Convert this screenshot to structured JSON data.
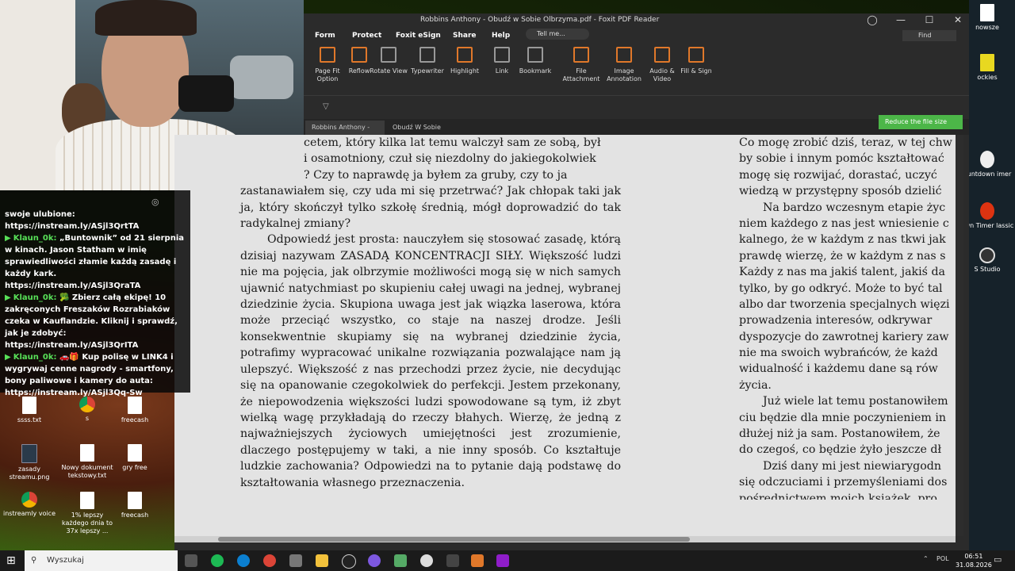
{
  "window": {
    "title": "Robbins Anthony - Obudź w Sobie Olbrzyma.pdf - Foxit PDF Reader"
  },
  "menu": [
    "Form",
    "Protect",
    "Foxit eSign",
    "Share",
    "Help"
  ],
  "tell_me": "Tell me...",
  "find": "Find",
  "ribbon": [
    "Page Fit Option",
    "Reflow",
    "Rotate View",
    "Typewriter",
    "Highlight",
    "Link",
    "Bookmark",
    "File Attachment",
    "Image Annotation",
    "Audio & Video",
    "Fill & Sign"
  ],
  "tabs": [
    "Robbins Anthony - O...",
    "Obudź W Sobie Olbrzym..."
  ],
  "reduce_button": "Reduce the file size",
  "page_left": [
    "cetem, który kilka lat temu walczył sam ze sobą, był",
    "i osamotniony, czuł się niezdolny do jakiegokolwiek",
    "? Czy to naprawdę ja byłem za gruby, czy to ja",
    "zastanawiałem się, czy uda mi się przetrwać? Jak chłopak taki jak ja, który skończył tylko szkołę średnią, mógł doprowadzić do tak radykalnej zmiany?",
    "Odpowiedź jest prosta: nauczyłem się stosować zasadę, którą dzisiaj nazywam ZASADĄ KONCENTRACJI SIŁY. Większość ludzi nie ma pojęcia, jak olbrzymie możliwości mogą się w nich samych ujawnić natychmiast po skupieniu całej uwagi na jednej, wybranej dziedzinie życia. Skupiona uwaga jest jak wiązka laserowa, która może przeciąć wszystko, co staje na naszej drodze. Jeśli konsekwentnie skupiamy się na wybranej dziedzinie życia, potrafimy wypracować unikalne rozwiązania pozwalające nam ją ulepszyć. Większość z nas przechodzi przez życie, nie decydując się na opanowanie czegokolwiek do perfekcji. Jestem przekonany, że niepowodzenia większości ludzi spowodowane są tym, iż zbyt wielką wagę przykładają do rzeczy błahych. Wierzę, że jedną z najważniejszych życiowych umiejętności jest zrozumienie, dlaczego postępujemy w taki, a nie inny sposób. Co kształtuje ludzkie zachowania? Odpowiedzi na to pytanie dają podstawę do kształtowania własnego przeznaczenia."
  ],
  "page_right": [
    "Co mogę zrobić dziś, teraz, w tej chw",
    "by sobie i innym pomóc kształtować",
    "mogę się rozwijać, dorastać, uczyć",
    "wiedzą w przystępny sposób dzielić",
    "Na bardzo wczesnym etapie życ",
    "niem każdego z nas jest wniesienie c",
    "kalnego, że w każdym z nas tkwi jak",
    "prawdę wierzę, że w każdym z nas s",
    "Każdy z nas ma jakiś talent, jakiś da",
    "tylko, by go odkryć. Może to być tal",
    "albo dar tworzenia specjalnych więzi",
    "prowadzenia interesów, odkrywar",
    "dyspozycje do zawrotnej kariery zaw",
    "nie ma swoich wybrańców, że każd",
    "widualność i każdemu dane są rów",
    "życia.",
    "Już wiele lat temu postanowiłem",
    "ciu będzie dla mnie poczynieniem in",
    "dłużej niż ja sam. Postanowiłem, że",
    "do czegoś, co będzie żyło jeszcze dł",
    "Dziś dany mi jest niewiarygodn",
    "się odczuciami i przemyśleniami dos",
    "pośrednictwem moich książek, pro"
  ],
  "page_right_indent": [
    4,
    16,
    20
  ],
  "chat": [
    {
      "user": "",
      "text": "swoje ulubione: https://instream.ly/ASjl3QrtTA"
    },
    {
      "user": "Klaun_0k:",
      "text": "„Buntownik” od 21 sierpnia w kinach. Jason Statham w imię sprawiedliwości złamie każdą zasadę i każdy kark. https://instream.ly/ASjl3QraTA"
    },
    {
      "user": "Klaun_0k:",
      "text": "🥦 Zbierz całą ekipę! 10 zakręconych Freszaków Rozrabiaków czeka w Kauflandzie. Kliknij i sprawdź, jak je zdobyć: https://instream.ly/ASjl3QrITA"
    },
    {
      "user": "Klaun_0k:",
      "text": "🚗🎁 Kup polisę w LINK4 i wygrywaj cenne nagrody - smartfony, bony paliwowe i kamery do auta: https://instream.ly/ASjl3Qq-Sw"
    }
  ],
  "desktop_icons": [
    {
      "label": "ssss.txt",
      "kind": "file"
    },
    {
      "label": "s",
      "kind": "chrome"
    },
    {
      "label": "freecash",
      "kind": "file"
    },
    {
      "label": "zasady streamu.png",
      "kind": "png"
    },
    {
      "label": "Nowy dokument tekstowy.txt",
      "kind": "file"
    },
    {
      "label": "gry free",
      "kind": "file"
    },
    {
      "label": "instreamly voice",
      "kind": "chrome"
    },
    {
      "label": "1% lepszy każdego dnia to 37x lepszy ...",
      "kind": "file"
    },
    {
      "label": "freecash",
      "kind": "file"
    },
    {
      "label": "nowsze",
      "kind": "file"
    },
    {
      "label": "ockies",
      "kind": "y"
    },
    {
      "label": "ountdown imer",
      "kind": "circle"
    },
    {
      "label": "own Timer lassic",
      "kind": "red"
    },
    {
      "label": "S Studio",
      "kind": "dark"
    }
  ],
  "taskbar": {
    "search": "Wyszukaj",
    "lang": "POL",
    "time": "06:51",
    "date": "31.08.2026"
  }
}
